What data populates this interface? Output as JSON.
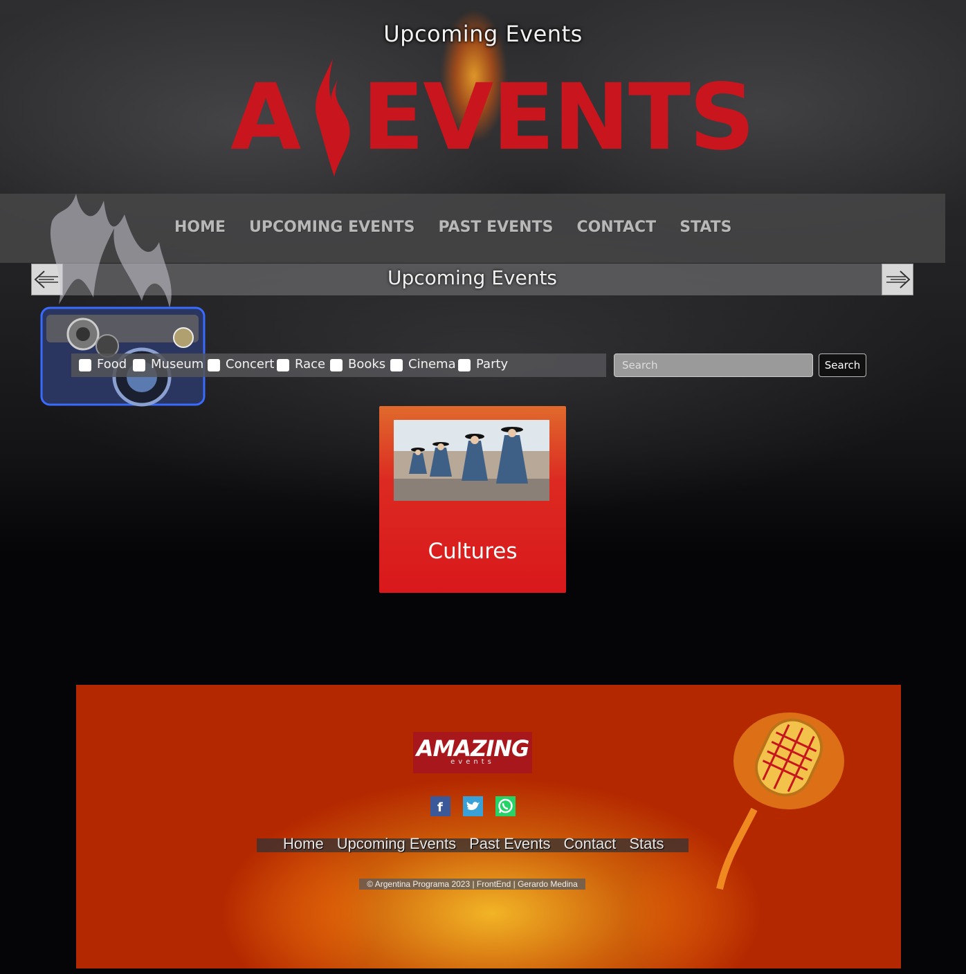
{
  "header": {
    "heading": "Upcoming Events",
    "logo": {
      "letter": "A",
      "word": "EVENTS",
      "color": "#c8151e"
    }
  },
  "nav": {
    "items": [
      "HOME",
      "UPCOMING EVENTS",
      "PAST EVENTS",
      "CONTACT",
      "STATS"
    ]
  },
  "subheader": {
    "title": "Upcoming Events",
    "prev_icon": "arrow-left-icon",
    "next_icon": "arrow-right-icon"
  },
  "filters": {
    "categories": [
      "Food",
      "Museum",
      "Concert",
      "Race",
      "Books",
      "Cinema",
      "Party"
    ],
    "search_placeholder": "Search",
    "search_button": "Search"
  },
  "events": [
    {
      "title": "Cultures"
    }
  ],
  "footer": {
    "logo_main": "AMAZING",
    "logo_sub": "events",
    "socials": [
      "facebook-icon",
      "twitter-icon",
      "whatsapp-icon"
    ],
    "nav": [
      "Home",
      "Upcoming Events",
      "Past Events",
      "Contact",
      "Stats"
    ],
    "copyright": "© Argentina Programa 2023 | FrontEnd | Gerardo Medina"
  }
}
